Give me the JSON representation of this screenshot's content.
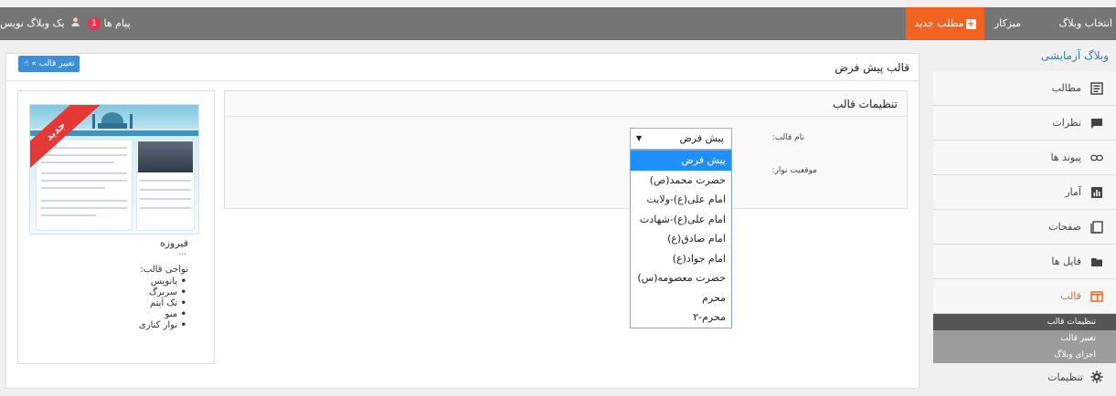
{
  "topbar": {
    "choose_blog": "انتخاب وبلاگ",
    "desk": "میزکار",
    "new_post": "مطلب جدید",
    "messages": "پیام ها",
    "messages_count": "1",
    "writer": "یک وبلاگ نویس"
  },
  "sidebar": {
    "blog_name": "وبلاگ آزمایشی",
    "items": [
      {
        "label": "مطالب",
        "icon": "posts-icon"
      },
      {
        "label": "نظرات",
        "icon": "comments-icon"
      },
      {
        "label": "پیوند ها",
        "icon": "link-icon"
      },
      {
        "label": "آمار",
        "icon": "stats-icon"
      },
      {
        "label": "صفحات",
        "icon": "pages-icon"
      },
      {
        "label": "فایل ها",
        "icon": "folder-icon"
      },
      {
        "label": "قالب",
        "icon": "template-icon"
      }
    ],
    "submenu": [
      "تنظیمات قالب",
      "تغییر قالب",
      "اجزای وبلاگ"
    ],
    "settings": "تنظیمات",
    "accent": "#f26322"
  },
  "main": {
    "title": "قالب پیش فرض",
    "change_button": "تغییر قالب »",
    "settings_title": "تنظیمات قالب",
    "name_label": "نام قالب:",
    "position_label": "موقعیت نوار:",
    "select_value": "پیش فرض",
    "options": [
      "پیش فرض",
      "حضرت محمد(ص)",
      "امام علی(ع)-ولایت",
      "امام علی(ع)-شهادت",
      "امام صادق(ع)",
      "امام جواد(ع)",
      "حضرت معصومه(س)",
      "محرم",
      "محرم-۲"
    ]
  },
  "preview": {
    "ribbon": "جدید",
    "template_name": "فیروزه",
    "dots": "...",
    "areas_title": "نواحی قالب:",
    "areas": [
      "پانویس",
      "سربرگ",
      "تک آیتم",
      "منو",
      "نوار کناری"
    ]
  }
}
